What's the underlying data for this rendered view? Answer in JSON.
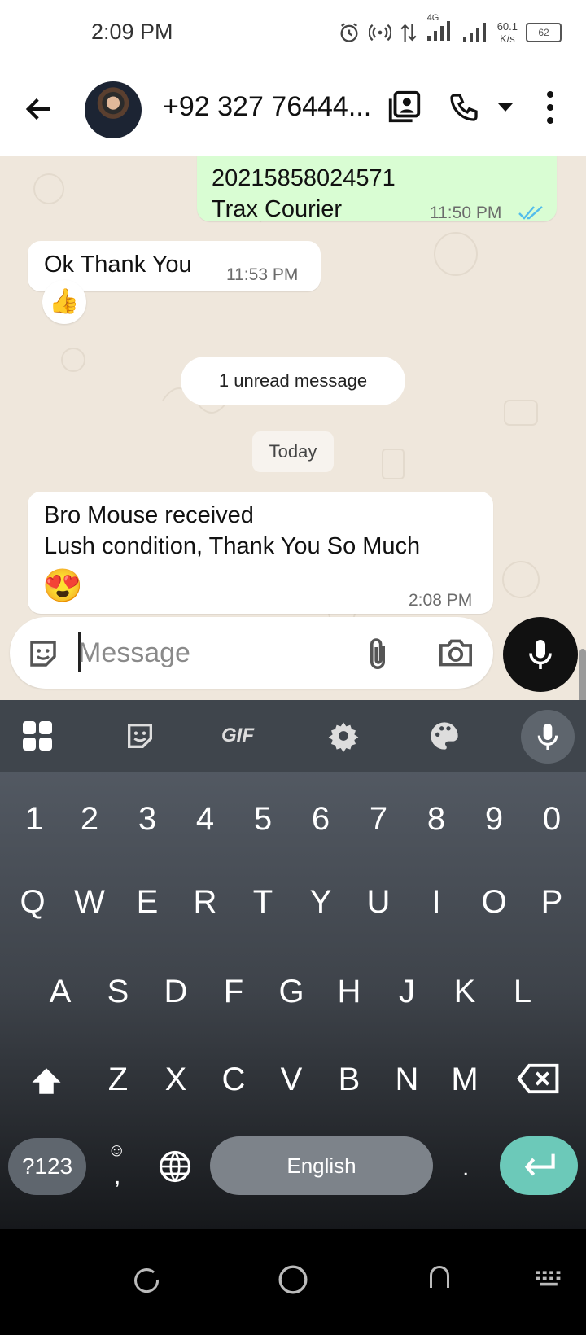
{
  "status_bar": {
    "time": "2:09 PM",
    "network": "4G",
    "speed_value": "60.1",
    "speed_unit": "K/s",
    "battery": "62",
    "icons": [
      "alarm-icon",
      "hotspot-icon",
      "data-arrows-icon",
      "signal-icon",
      "signal-icon",
      "battery-icon"
    ]
  },
  "header": {
    "contact_name": "+92 327 76444...",
    "icons": [
      "back-arrow-icon",
      "avatar",
      "contact-card-icon",
      "phone-icon",
      "dropdown-icon",
      "more-vert-icon"
    ]
  },
  "messages": [
    {
      "direction": "outgoing",
      "lines": [
        "20215858024571",
        "Trax Courier"
      ],
      "time": "11:50 PM",
      "status": "read"
    },
    {
      "direction": "incoming",
      "lines": [
        "Ok Thank You"
      ],
      "time": "11:53 PM",
      "reaction": "👍"
    },
    {
      "direction": "incoming",
      "lines": [
        "Bro Mouse received",
        "Lush condition, Thank You So Much",
        "😍"
      ],
      "time": "2:08 PM"
    }
  ],
  "unread_label": "1 unread message",
  "date_label": "Today",
  "composer": {
    "placeholder": "Message",
    "icons": [
      "sticker-icon",
      "attach-icon",
      "camera-icon",
      "mic-icon"
    ]
  },
  "keyboard": {
    "toolbar": {
      "gif_label": "GIF",
      "icons": [
        "apps-grid-icon",
        "sticker-icon",
        "gif-icon",
        "settings-icon",
        "palette-icon",
        "mic-icon"
      ]
    },
    "row_numbers": [
      "1",
      "2",
      "3",
      "4",
      "5",
      "6",
      "7",
      "8",
      "9",
      "0"
    ],
    "row1": [
      "Q",
      "W",
      "E",
      "R",
      "T",
      "Y",
      "U",
      "I",
      "O",
      "P"
    ],
    "row2": [
      "A",
      "S",
      "D",
      "F",
      "G",
      "H",
      "J",
      "K",
      "L"
    ],
    "row3": [
      "Z",
      "X",
      "C",
      "V",
      "B",
      "N",
      "M"
    ],
    "symbols_key": "?123",
    "emoji_comma": ",",
    "space_label": "English",
    "period": "."
  },
  "nav_bar": {
    "icons": [
      "recents-icon",
      "home-icon",
      "back-icon",
      "keyboard-switch-icon"
    ]
  },
  "colors": {
    "outgoing_bubble": "#d9fdd3",
    "enter_key": "#6cc9b9",
    "read_ticks": "#53bdeb"
  }
}
